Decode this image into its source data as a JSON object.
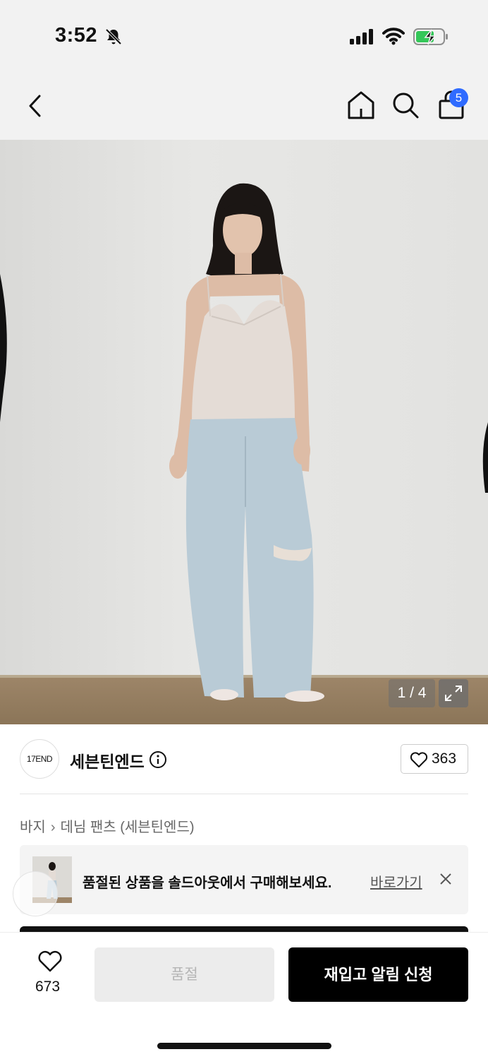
{
  "status_bar": {
    "time": "3:52",
    "battery_state": "charging"
  },
  "nav": {
    "cart_count": "5",
    "icons": [
      "back-chevron-icon",
      "home-icon",
      "search-icon",
      "shopping-bag-icon"
    ]
  },
  "gallery": {
    "counter": "1 / 4"
  },
  "brand": {
    "logo_text": "17END",
    "name": "세븐틴엔드",
    "likes": "363"
  },
  "breadcrumb": {
    "parent": "바지",
    "current": "데님 팬츠 (세븐틴엔드)"
  },
  "soldout_banner": {
    "message": "품절된 상품을 솔드아웃에서 구매해보세요.",
    "link_label": "바로가기"
  },
  "bottom_bar": {
    "wish_count": "673",
    "soldout_label": "품절",
    "restock_label": "재입고 알림 신청"
  },
  "colors": {
    "accent_badge": "#2f6bff",
    "primary_button": "#000000",
    "disabled_button": "#ececec",
    "battery_charge": "#34c759"
  }
}
